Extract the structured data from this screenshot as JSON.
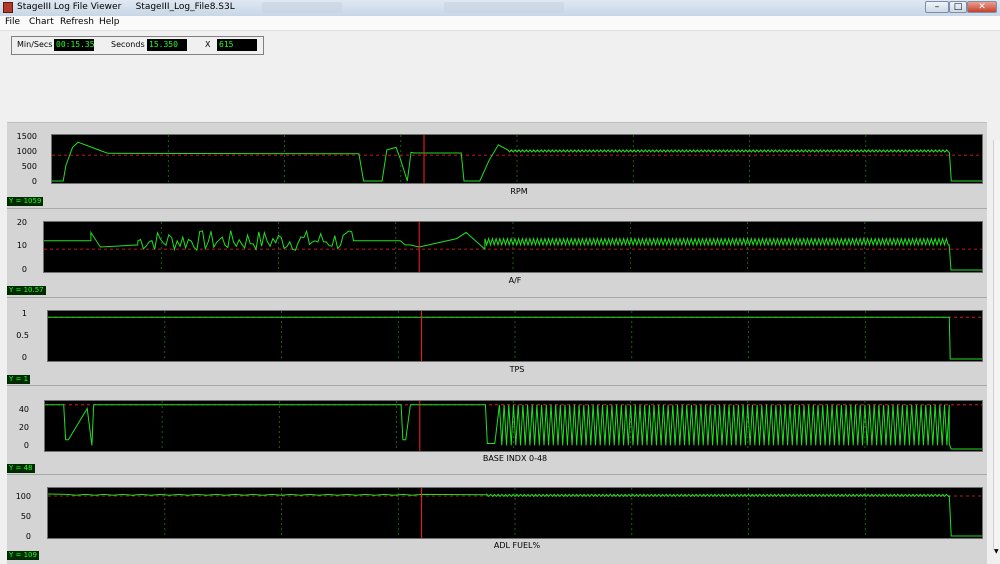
{
  "window": {
    "title": "StageIII Log File Viewer     StageIII_Log_File8.S3L",
    "minimize": "–",
    "maximize": "□",
    "close": "✕"
  },
  "menu": [
    "File",
    "Chart",
    "Refresh",
    "Help"
  ],
  "info": {
    "minsecs_label": "Min/Secs",
    "minsecs_value": "00:15.35",
    "seconds_label": "Seconds",
    "seconds_value": "15.350",
    "x_label": "X",
    "x_value": "615"
  },
  "colors": {
    "trace": "#20e020",
    "grid": "#1e7a1e",
    "marker": "#ff2020"
  },
  "cursor_fraction": 0.4,
  "panels": [
    {
      "title": "RPM",
      "y_readout": "Y = 1059",
      "ticks": [
        "1500",
        "1000",
        "500",
        "0"
      ],
      "ylim": [
        0,
        1700
      ],
      "ref_level": 1000
    },
    {
      "title": "A/F",
      "y_readout": "Y = 10.57",
      "ticks": [
        "20",
        "10",
        "0"
      ],
      "ylim": [
        0,
        22
      ],
      "ref_level": 10
    },
    {
      "title": "TPS",
      "y_readout": "Y = 1",
      "ticks": [
        "1",
        "0.5",
        "0"
      ],
      "ylim": [
        0,
        1.1
      ],
      "ref_level": 1
    },
    {
      "title": "BASE INDX 0-48",
      "y_readout": "Y = 48",
      "ticks": [
        "40",
        "20",
        "0"
      ],
      "ylim": [
        0,
        50
      ],
      "ref_level": 48
    },
    {
      "title": "ADL FUEL%",
      "y_readout": "Y = 109",
      "ticks": [
        "100",
        "50",
        "0"
      ],
      "ylim": [
        0,
        115
      ],
      "ref_level": 100
    }
  ]
}
